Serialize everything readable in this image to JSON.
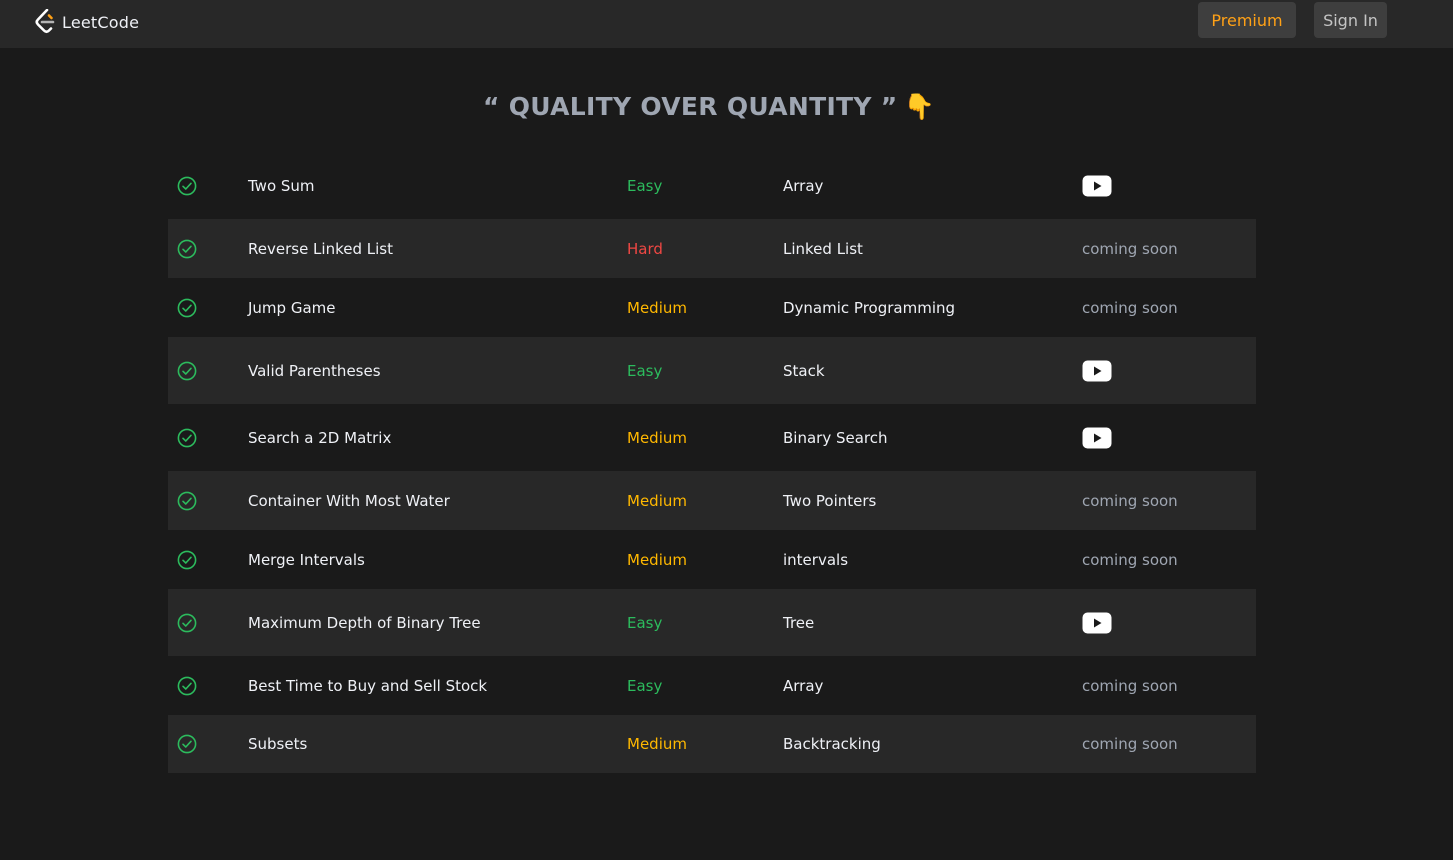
{
  "nav": {
    "logo_text": "LeetCode",
    "premium_label": "Premium",
    "signin_label": "Sign In"
  },
  "heading": {
    "text": "“ QUALITY OVER QUANTITY ”",
    "emoji": "👇"
  },
  "colors": {
    "easy": "#2cbb5d",
    "medium": "#ffb800",
    "hard": "#ef4743",
    "accent": "#ffa116"
  },
  "problems": [
    {
      "title": "Two Sum",
      "difficulty": "Easy",
      "topic": "Array",
      "video": "youtube-icon",
      "status": "solved"
    },
    {
      "title": "Reverse Linked List",
      "difficulty": "Hard",
      "topic": "Linked List",
      "video": "coming soon",
      "status": "solved"
    },
    {
      "title": "Jump Game",
      "difficulty": "Medium",
      "topic": "Dynamic Programming",
      "video": "coming soon",
      "status": "solved"
    },
    {
      "title": "Valid Parentheses",
      "difficulty": "Easy",
      "topic": "Stack",
      "video": "youtube-icon",
      "status": "solved"
    },
    {
      "title": "Search a 2D Matrix",
      "difficulty": "Medium",
      "topic": "Binary Search",
      "video": "youtube-icon",
      "status": "solved"
    },
    {
      "title": "Container With Most Water",
      "difficulty": "Medium",
      "topic": "Two Pointers",
      "video": "coming soon",
      "status": "solved"
    },
    {
      "title": "Merge Intervals",
      "difficulty": "Medium",
      "topic": "intervals",
      "video": "coming soon",
      "status": "solved"
    },
    {
      "title": "Maximum Depth of Binary Tree",
      "difficulty": "Easy",
      "topic": "Tree",
      "video": "youtube-icon",
      "status": "solved"
    },
    {
      "title": "Best Time to Buy and Sell Stock",
      "difficulty": "Easy",
      "topic": "Array",
      "video": "coming soon",
      "status": "solved"
    },
    {
      "title": "Subsets",
      "difficulty": "Medium",
      "topic": "Backtracking",
      "video": "coming soon",
      "status": "solved"
    }
  ]
}
